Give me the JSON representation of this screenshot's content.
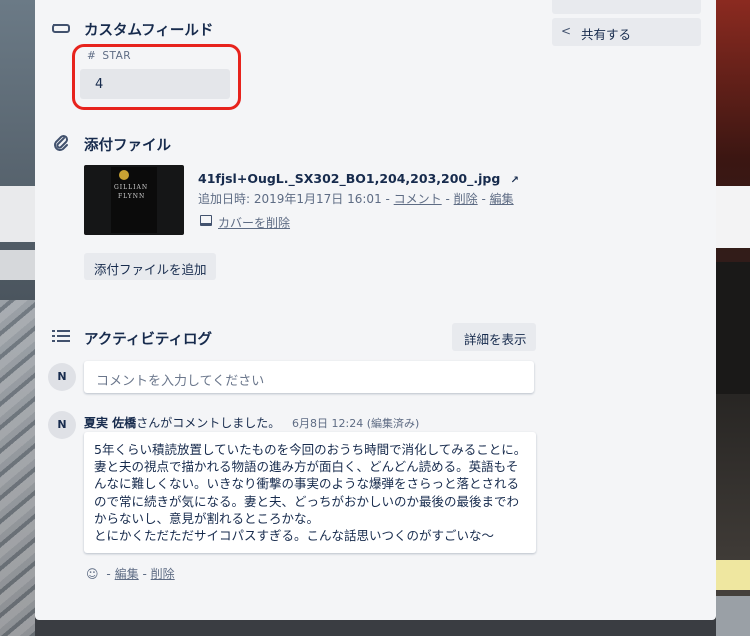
{
  "sidebar": {
    "share_label": "共有する"
  },
  "custom_fields": {
    "title": "カスタムフィールド",
    "field": {
      "name": "STAR",
      "value": "4"
    }
  },
  "attachments": {
    "title": "添付ファイル",
    "item": {
      "filename": "41fjsl+OugL._SX302_BO1,204,203,200_.jpg",
      "added_prefix": "追加日時: 2019年1月17日 16:01 - ",
      "comment_link": "コメント",
      "delete_link": "削除",
      "edit_link": "編集",
      "remove_cover": "カバーを削除"
    },
    "add_button": "添付ファイルを追加"
  },
  "activity": {
    "title": "アクティビティログ",
    "detail_button": "詳細を表示",
    "comment_placeholder": "コメントを入力してください",
    "avatar_initial": "N",
    "comment": {
      "author": "夏実 佐橋",
      "action": "さんがコメントしました。",
      "time": "6月8日 12:24 (編集済み)",
      "lines": [
        "5年くらい積読放置していたものを今回のおうち時間で消化してみることに。",
        "妻と夫の視点で描かれる物語の進み方が面白く、どんどん読める。英語もそ",
        "んなに難しくない。いきなり衝撃の事実のような爆弾をさらっと落とされる",
        "ので常に続きが気になる。妻と夫、どっちがおかしいのか最後の最後までわ",
        "からないし、意見が割れるところかな。",
        "とにかくただただサイコパスすぎる。こんな話思いつくのがすごいな〜"
      ],
      "edit_link": "編集",
      "delete_link": "削除"
    }
  },
  "colors": {
    "annotation_ring": "#e7231d",
    "modal_bg": "#f4f5f7",
    "text_primary": "#172b4d"
  }
}
